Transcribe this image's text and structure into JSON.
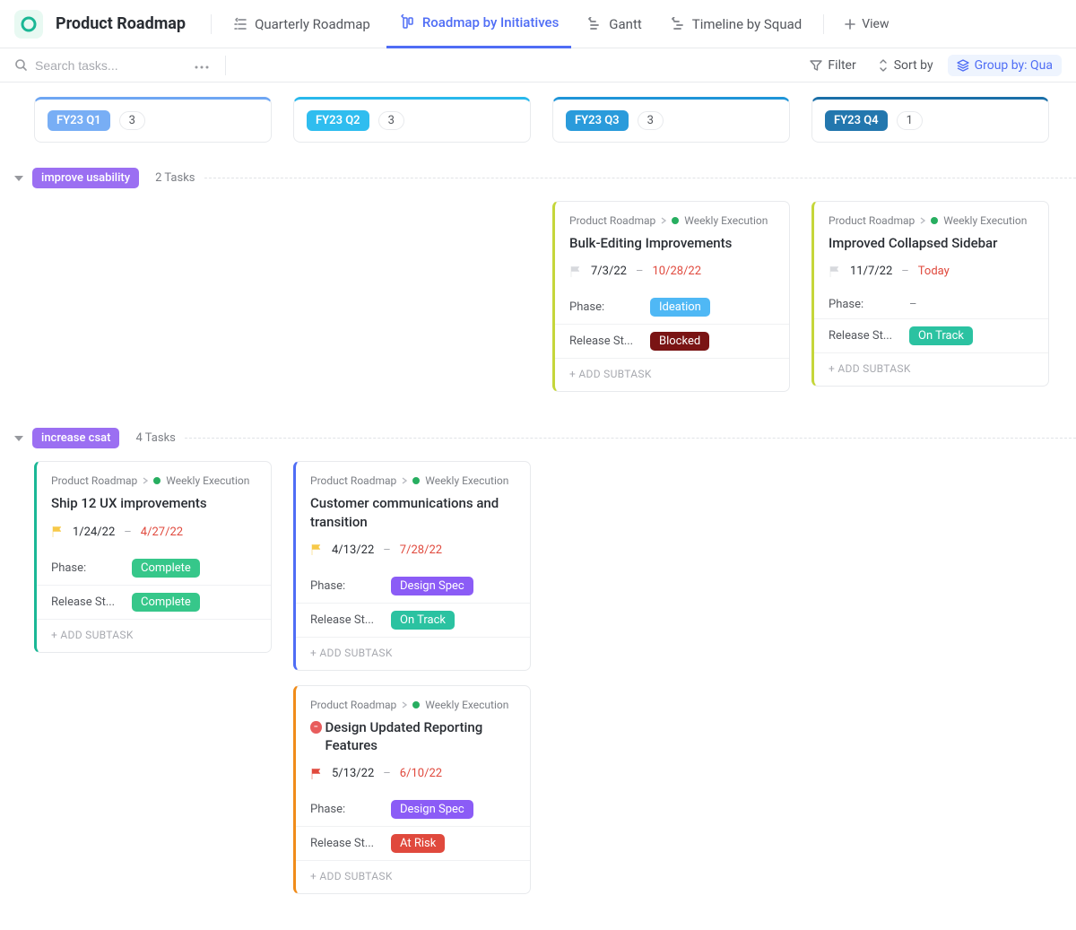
{
  "header": {
    "page_title": "Product Roadmap",
    "tabs": [
      {
        "label": "Quarterly Roadmap"
      },
      {
        "label": "Roadmap by Initiatives"
      },
      {
        "label": "Gantt"
      },
      {
        "label": "Timeline by Squad"
      }
    ],
    "add_view_label": "View"
  },
  "toolbar": {
    "search_placeholder": "Search tasks...",
    "filter_label": "Filter",
    "sort_label": "Sort by",
    "group_label": "Group by: Qua"
  },
  "columns": [
    {
      "name": "FY23 Q1",
      "count": "3",
      "top_color": "#6ea6f3",
      "pill_bg": "#78aef5"
    },
    {
      "name": "FY23 Q2",
      "count": "3",
      "top_color": "#28b8ec",
      "pill_bg": "#2fbdef"
    },
    {
      "name": "FY23 Q3",
      "count": "3",
      "top_color": "#1f95d8",
      "pill_bg": "#2a9bdb"
    },
    {
      "name": "FY23 Q4",
      "count": "1",
      "top_color": "#1a6fa8",
      "pill_bg": "#2377ae"
    }
  ],
  "groups": [
    {
      "name": "improve usability",
      "color": "#9b6ff2",
      "count_label": "2 Tasks",
      "cards": {
        "2": [
          {
            "crumb_space": "Product Roadmap",
            "crumb_list": "Weekly Execution",
            "title": "Bulk-Editing Improvements",
            "flag_color": "#d7d9dd",
            "start": "7/3/22",
            "end": "10/28/22",
            "phase_label": "Phase:",
            "phase_value": "Ideation",
            "phase_bg": "#4fb8f5",
            "rs_label": "Release St...",
            "rs_value": "Blocked",
            "rs_bg": "#7a1414",
            "border": "#c5d63a",
            "add_label": "+ ADD SUBTASK"
          }
        ],
        "3": [
          {
            "crumb_space": "Product Roadmap",
            "crumb_list": "Weekly Execution",
            "title": "Improved Collapsed Sidebar",
            "flag_color": "#d7d9dd",
            "start": "11/7/22",
            "end": "Today",
            "phase_label": "Phase:",
            "phase_value": "–",
            "phase_plain": true,
            "rs_label": "Release St...",
            "rs_value": "On Track",
            "rs_bg": "#2bc2a1",
            "border": "#c5d63a",
            "add_label": "+ ADD SUBTASK"
          }
        ]
      }
    },
    {
      "name": "increase csat",
      "color": "#9b6ff2",
      "count_label": "4 Tasks",
      "cards": {
        "0": [
          {
            "crumb_space": "Product Roadmap",
            "crumb_list": "Weekly Execution",
            "title": "Ship 12 UX improvements",
            "flag_color": "#f7c948",
            "start": "1/24/22",
            "end": "4/27/22",
            "phase_label": "Phase:",
            "phase_value": "Complete",
            "phase_bg": "#36c78a",
            "rs_label": "Release St...",
            "rs_value": "Complete",
            "rs_bg": "#36c78a",
            "border": "#1ab795",
            "add_label": "+ ADD SUBTASK"
          }
        ],
        "1": [
          {
            "crumb_space": "Product Roadmap",
            "crumb_list": "Weekly Execution",
            "title": "Customer communications and transition",
            "flag_color": "#f7c948",
            "start": "4/13/22",
            "end": "7/28/22",
            "phase_label": "Phase:",
            "phase_value": "Design Spec",
            "phase_bg": "#8b5cf6",
            "rs_label": "Release St...",
            "rs_value": "On Track",
            "rs_bg": "#2bc2a1",
            "border": "#4f6df5",
            "add_label": "+ ADD SUBTASK"
          },
          {
            "crumb_space": "Product Roadmap",
            "crumb_list": "Weekly Execution",
            "title": "Design Updated Reporting Features",
            "blocked": true,
            "flag_color": "#e0493d",
            "start": "5/13/22",
            "end": "6/10/22",
            "phase_label": "Phase:",
            "phase_value": "Design Spec",
            "phase_bg": "#8b5cf6",
            "rs_label": "Release St...",
            "rs_value": "At Risk",
            "rs_bg": "#e0493d",
            "border": "#f08c1a",
            "add_label": "+ ADD SUBTASK"
          }
        ]
      }
    }
  ]
}
